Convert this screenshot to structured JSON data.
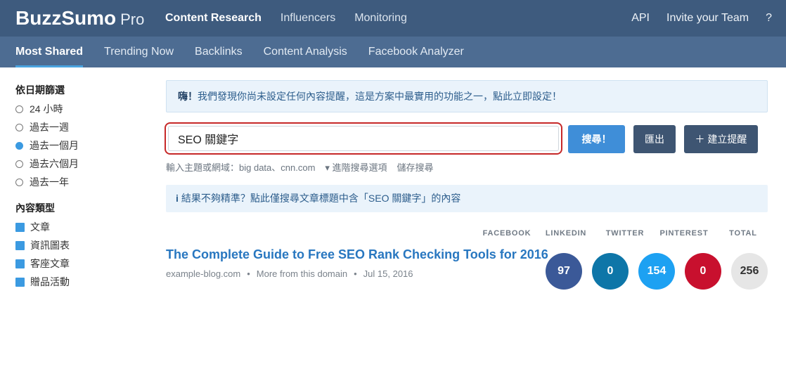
{
  "brand": {
    "name": "BuzzSumo",
    "tier": "Pro"
  },
  "topnav": {
    "items": [
      {
        "label": "Content Research",
        "active": true
      },
      {
        "label": "Influencers",
        "active": false
      },
      {
        "label": "Monitoring",
        "active": false
      }
    ],
    "right": [
      "API",
      "Invite your Team",
      "?"
    ]
  },
  "subnav": {
    "items": [
      {
        "label": "Most Shared",
        "active": true
      },
      {
        "label": "Trending Now",
        "active": false
      },
      {
        "label": "Backlinks",
        "active": false
      },
      {
        "label": "Content Analysis",
        "active": false
      },
      {
        "label": "Facebook Analyzer",
        "active": false
      }
    ]
  },
  "sidebar": {
    "date_heading": "依日期篩選",
    "date_options": [
      {
        "label": "24 小時",
        "selected": false
      },
      {
        "label": "過去一週",
        "selected": false
      },
      {
        "label": "過去一個月",
        "selected": true
      },
      {
        "label": "過去六個月",
        "selected": false
      },
      {
        "label": "過去一年",
        "selected": false
      }
    ],
    "type_heading": "內容類型",
    "type_options": [
      {
        "label": "文章",
        "checked": true
      },
      {
        "label": "資訊圖表",
        "checked": true
      },
      {
        "label": "客座文章",
        "checked": true
      },
      {
        "label": "贈品活動",
        "checked": true
      }
    ]
  },
  "alert": {
    "strong": "嗨！",
    "text": "我們發現你尚未設定任何內容提醒，這是方案中最實用的功能之一，點此立即設定！"
  },
  "search": {
    "value": "SEO 關鍵字",
    "search_label": "搜尋！",
    "export_label": "匯出",
    "create_alert_label": "＋ 建立提醒",
    "hint": "輸入主題或網域：big data、cnn.com",
    "advanced_label": "▾ 進階搜尋選項",
    "save_label": "儲存搜尋"
  },
  "title_only_notice": {
    "icon": "i",
    "text": "結果不夠精準？點此僅搜尋文章標題中含「SEO 關鍵字」的內容"
  },
  "columns": [
    "FACEBOOK",
    "LINKEDIN",
    "TWITTER",
    "PINTEREST",
    "TOTAL"
  ],
  "result": {
    "title": "The Complete Guide to Free SEO Rank Checking Tools for 2016",
    "domain": "example-blog.com",
    "more_from_domain": "More from this domain",
    "date": "Jul 15, 2016",
    "shares": {
      "facebook": "97",
      "linkedin": "0",
      "twitter": "154",
      "pinterest": "0",
      "total": "256"
    }
  },
  "colors": {
    "topbar": "#3e5b7e",
    "subbar": "#4d6c92",
    "accent": "#3f8ed8",
    "facebook": "#3b5998",
    "linkedin": "#0e76a8",
    "twitter": "#1da1f2",
    "pinterest": "#c8102e",
    "total": "#e6e6e6"
  }
}
